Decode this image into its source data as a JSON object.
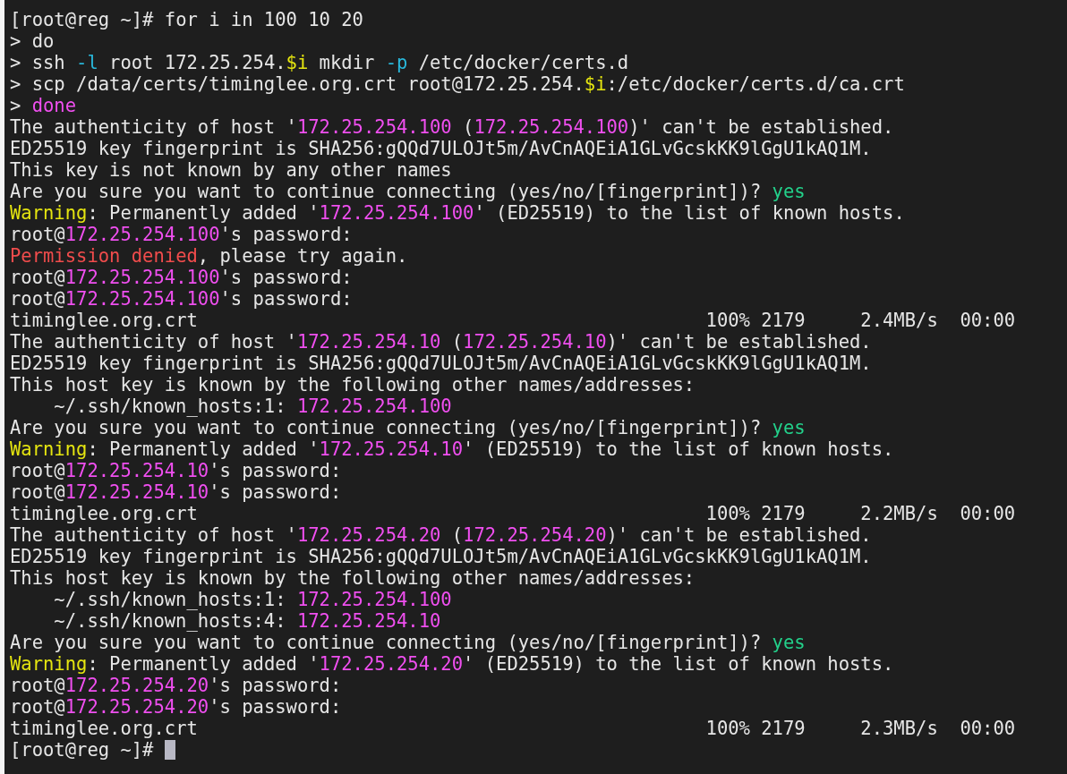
{
  "terminal": {
    "lines": [
      {
        "kind": "text",
        "segments": [
          {
            "text": "[root@reg ~]# for i in 100 10 20",
            "kind": "plain"
          }
        ]
      },
      {
        "kind": "text",
        "segments": [
          {
            "text": "> do",
            "kind": "plain"
          }
        ]
      },
      {
        "kind": "text",
        "segments": [
          {
            "text": "> ssh ",
            "kind": "plain"
          },
          {
            "text": "-l",
            "kind": "option"
          },
          {
            "text": " root 172.25.254.",
            "kind": "plain"
          },
          {
            "text": "$i",
            "kind": "variable"
          },
          {
            "text": " mkdir ",
            "kind": "plain"
          },
          {
            "text": "-p",
            "kind": "option"
          },
          {
            "text": " /etc/docker/certs.d",
            "kind": "plain"
          }
        ]
      },
      {
        "kind": "text",
        "segments": [
          {
            "text": "> scp /data/certs/timinglee.org.crt root@172.25.254.",
            "kind": "plain"
          },
          {
            "text": "$i",
            "kind": "variable"
          },
          {
            "text": ":/etc/docker/certs.d/ca.crt",
            "kind": "plain"
          }
        ]
      },
      {
        "kind": "text",
        "segments": [
          {
            "text": "> ",
            "kind": "plain"
          },
          {
            "text": "done",
            "kind": "keyword"
          }
        ]
      },
      {
        "kind": "text",
        "segments": [
          {
            "text": "The authenticity of host '",
            "kind": "plain"
          },
          {
            "text": "172.25.254.100",
            "kind": "address"
          },
          {
            "text": " (",
            "kind": "plain"
          },
          {
            "text": "172.25.254.100",
            "kind": "address"
          },
          {
            "text": ")' can't be established.",
            "kind": "plain"
          }
        ]
      },
      {
        "kind": "text",
        "segments": [
          {
            "text": "ED25519 key fingerprint is SHA256:gQQd7ULOJt5m/AvCnAQEiA1GLvGcskKK9lGgU1kAQ1M.",
            "kind": "plain"
          }
        ]
      },
      {
        "kind": "text",
        "segments": [
          {
            "text": "This key is not known by any other names",
            "kind": "plain"
          }
        ]
      },
      {
        "kind": "text",
        "segments": [
          {
            "text": "Are you sure you want to continue connecting (yes/no/[fingerprint])? ",
            "kind": "plain"
          },
          {
            "text": "yes",
            "kind": "answer"
          }
        ]
      },
      {
        "kind": "text",
        "segments": [
          {
            "text": "Warning",
            "kind": "warning"
          },
          {
            "text": ": Permanently added '",
            "kind": "plain"
          },
          {
            "text": "172.25.254.100",
            "kind": "address"
          },
          {
            "text": "' (ED25519) to the list of known hosts.",
            "kind": "plain"
          }
        ]
      },
      {
        "kind": "text",
        "segments": [
          {
            "text": "root@",
            "kind": "plain"
          },
          {
            "text": "172.25.254.100",
            "kind": "address"
          },
          {
            "text": "'s password:",
            "kind": "plain"
          }
        ]
      },
      {
        "kind": "text",
        "segments": [
          {
            "text": "Permission denied",
            "kind": "error"
          },
          {
            "text": ", please try again.",
            "kind": "plain"
          }
        ]
      },
      {
        "kind": "text",
        "segments": [
          {
            "text": "root@",
            "kind": "plain"
          },
          {
            "text": "172.25.254.100",
            "kind": "address"
          },
          {
            "text": "'s password:",
            "kind": "plain"
          }
        ]
      },
      {
        "kind": "text",
        "segments": [
          {
            "text": "root@",
            "kind": "plain"
          },
          {
            "text": "172.25.254.100",
            "kind": "address"
          },
          {
            "text": "'s password:",
            "kind": "plain"
          }
        ]
      },
      {
        "kind": "transfer",
        "file": "timinglee.org.crt",
        "percent": "100%",
        "size": "2179",
        "speed": "2.4MB/s",
        "eta": "00:00"
      },
      {
        "kind": "text",
        "segments": [
          {
            "text": "The authenticity of host '",
            "kind": "plain"
          },
          {
            "text": "172.25.254.10",
            "kind": "address"
          },
          {
            "text": " (",
            "kind": "plain"
          },
          {
            "text": "172.25.254.10",
            "kind": "address"
          },
          {
            "text": ")' can't be established.",
            "kind": "plain"
          }
        ]
      },
      {
        "kind": "text",
        "segments": [
          {
            "text": "ED25519 key fingerprint is SHA256:gQQd7ULOJt5m/AvCnAQEiA1GLvGcskKK9lGgU1kAQ1M.",
            "kind": "plain"
          }
        ]
      },
      {
        "kind": "text",
        "segments": [
          {
            "text": "This host key is known by the following other names/addresses:",
            "kind": "plain"
          }
        ]
      },
      {
        "kind": "indented",
        "segments": [
          {
            "text": "~/.ssh/known_hosts:1: ",
            "kind": "plain"
          },
          {
            "text": "172.25.254.100",
            "kind": "address"
          }
        ]
      },
      {
        "kind": "text",
        "segments": [
          {
            "text": "Are you sure you want to continue connecting (yes/no/[fingerprint])? ",
            "kind": "plain"
          },
          {
            "text": "yes",
            "kind": "answer"
          }
        ]
      },
      {
        "kind": "text",
        "segments": [
          {
            "text": "Warning",
            "kind": "warning"
          },
          {
            "text": ": Permanently added '",
            "kind": "plain"
          },
          {
            "text": "172.25.254.10",
            "kind": "address"
          },
          {
            "text": "' (ED25519) to the list of known hosts.",
            "kind": "plain"
          }
        ]
      },
      {
        "kind": "text",
        "segments": [
          {
            "text": "root@",
            "kind": "plain"
          },
          {
            "text": "172.25.254.10",
            "kind": "address"
          },
          {
            "text": "'s password:",
            "kind": "plain"
          }
        ]
      },
      {
        "kind": "text",
        "segments": [
          {
            "text": "root@",
            "kind": "plain"
          },
          {
            "text": "172.25.254.10",
            "kind": "address"
          },
          {
            "text": "'s password:",
            "kind": "plain"
          }
        ]
      },
      {
        "kind": "transfer",
        "file": "timinglee.org.crt",
        "percent": "100%",
        "size": "2179",
        "speed": "2.2MB/s",
        "eta": "00:00"
      },
      {
        "kind": "text",
        "segments": [
          {
            "text": "The authenticity of host '",
            "kind": "plain"
          },
          {
            "text": "172.25.254.20",
            "kind": "address"
          },
          {
            "text": " (",
            "kind": "plain"
          },
          {
            "text": "172.25.254.20",
            "kind": "address"
          },
          {
            "text": ")' can't be established.",
            "kind": "plain"
          }
        ]
      },
      {
        "kind": "text",
        "segments": [
          {
            "text": "ED25519 key fingerprint is SHA256:gQQd7ULOJt5m/AvCnAQEiA1GLvGcskKK9lGgU1kAQ1M.",
            "kind": "plain"
          }
        ]
      },
      {
        "kind": "text",
        "segments": [
          {
            "text": "This host key is known by the following other names/addresses:",
            "kind": "plain"
          }
        ]
      },
      {
        "kind": "indented",
        "segments": [
          {
            "text": "~/.ssh/known_hosts:1: ",
            "kind": "plain"
          },
          {
            "text": "172.25.254.100",
            "kind": "address"
          }
        ]
      },
      {
        "kind": "indented",
        "segments": [
          {
            "text": "~/.ssh/known_hosts:4: ",
            "kind": "plain"
          },
          {
            "text": "172.25.254.10",
            "kind": "address"
          }
        ]
      },
      {
        "kind": "text",
        "segments": [
          {
            "text": "Are you sure you want to continue connecting (yes/no/[fingerprint])? ",
            "kind": "plain"
          },
          {
            "text": "yes",
            "kind": "answer"
          }
        ]
      },
      {
        "kind": "text",
        "segments": [
          {
            "text": "Warning",
            "kind": "warning"
          },
          {
            "text": ": Permanently added '",
            "kind": "plain"
          },
          {
            "text": "172.25.254.20",
            "kind": "address"
          },
          {
            "text": "' (ED25519) to the list of known hosts.",
            "kind": "plain"
          }
        ]
      },
      {
        "kind": "text",
        "segments": [
          {
            "text": "root@",
            "kind": "plain"
          },
          {
            "text": "172.25.254.20",
            "kind": "address"
          },
          {
            "text": "'s password:",
            "kind": "plain"
          }
        ]
      },
      {
        "kind": "text",
        "segments": [
          {
            "text": "root@",
            "kind": "plain"
          },
          {
            "text": "172.25.254.20",
            "kind": "address"
          },
          {
            "text": "'s password:",
            "kind": "plain"
          }
        ]
      },
      {
        "kind": "transfer",
        "file": "timinglee.org.crt",
        "percent": "100%",
        "size": "2179",
        "speed": "2.3MB/s",
        "eta": "00:00"
      },
      {
        "kind": "prompt",
        "segments": [
          {
            "text": "[root@reg ~]#",
            "kind": "plain"
          }
        ]
      }
    ]
  }
}
